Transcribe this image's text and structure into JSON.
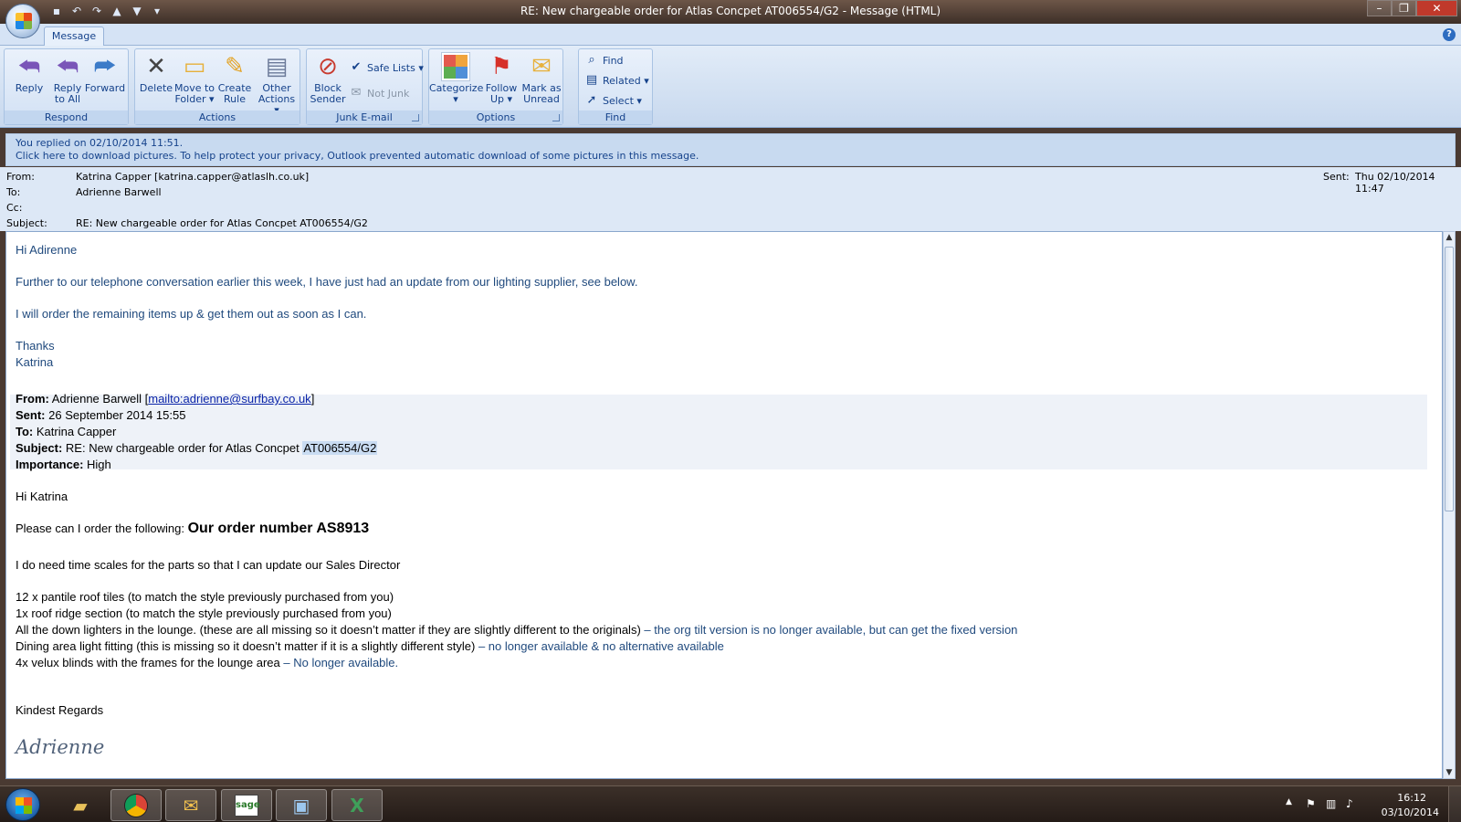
{
  "window": {
    "title": "RE: New chargeable order for Atlas Concpet AT006554/G2  -  Message (HTML)"
  },
  "tabs": [
    "Message"
  ],
  "ribbon": {
    "respond": {
      "label": "Respond",
      "reply": "Reply",
      "reply_all": "Reply\nto All",
      "forward": "Forward"
    },
    "actions": {
      "label": "Actions",
      "delete": "Delete",
      "move": "Move to\nFolder ▾",
      "rule": "Create\nRule",
      "other": "Other\nActions ▾"
    },
    "junk": {
      "label": "Junk E-mail",
      "block": "Block\nSender",
      "safe": "Safe Lists ▾",
      "notjunk": "Not Junk"
    },
    "options": {
      "label": "Options",
      "categorize": "Categorize\n▾",
      "follow": "Follow\nUp ▾",
      "unread": "Mark as\nUnread"
    },
    "find": {
      "label": "Find",
      "find": "Find",
      "related": "Related ▾",
      "select": "Select ▾"
    }
  },
  "infobar": {
    "line1": "You replied on 02/10/2014 11:51.",
    "line2": "Click here to download pictures. To help protect your privacy, Outlook prevented automatic download of some pictures in this message."
  },
  "headers": {
    "from_label": "From:",
    "from": "Katrina Capper [katrina.capper@atlaslh.co.uk]",
    "to_label": "To:",
    "to": "Adrienne Barwell",
    "cc_label": "Cc:",
    "cc": "",
    "subject_label": "Subject:",
    "subject": "RE: New chargeable order for Atlas Concpet AT006554/G2",
    "sent_label": "Sent:",
    "sent": "Thu 02/10/2014 11:47"
  },
  "body": {
    "greeting": "Hi Adirenne",
    "p1": "Further to our telephone conversation earlier this week, I have just had an update from our lighting supplier, see below.",
    "p2": "I will order the remaining items up & get them out as soon as I can.",
    "thanks": "Thanks",
    "signoff": "Katrina",
    "quoted": {
      "from_label": "From:",
      "from_name": "Adrienne Barwell [",
      "from_link": "mailto:adrienne@surfbay.co.uk",
      "from_close": "]",
      "sent_label": "Sent:",
      "sent": "26 September 2014 15:55",
      "to_label": "To:",
      "to": "Katrina Capper",
      "subject_label": "Subject:",
      "subject_pre": "RE: New chargeable order for Atlas Concpet ",
      "subject_ref": "AT006554/G2",
      "importance_label": "Importance:",
      "importance": "High"
    },
    "greeting2": "Hi Katrina",
    "order_intro": "Please can I order the following: ",
    "order_number": "Our order number AS8913",
    "timescales": "I do need time scales for the parts so that I can update our Sales Director",
    "items": [
      {
        "text": "12 x pantile roof tiles (to match the style previously purchased from you)",
        "note": ""
      },
      {
        "text": "1x roof ridge section (to match the style previously purchased from you)",
        "note": ""
      },
      {
        "text": "All the down lighters in the lounge. (these are all missing so it doesn’t matter if they are slightly different to the originals) ",
        "note": "– the org tilt version is no longer available, but can get the fixed version"
      },
      {
        "text": "Dining area light fitting (this is missing so it doesn’t matter if it is a slightly different style) ",
        "note": "– no longer available & no alternative available"
      },
      {
        "text": "4x velux blinds with the frames for the lounge area ",
        "note": "– No longer available."
      }
    ],
    "regards": "Kindest Regards",
    "signature": "Adrienne"
  },
  "taskbar": {
    "time": "16:12",
    "date": "03/10/2014",
    "sage_label": "sage"
  }
}
